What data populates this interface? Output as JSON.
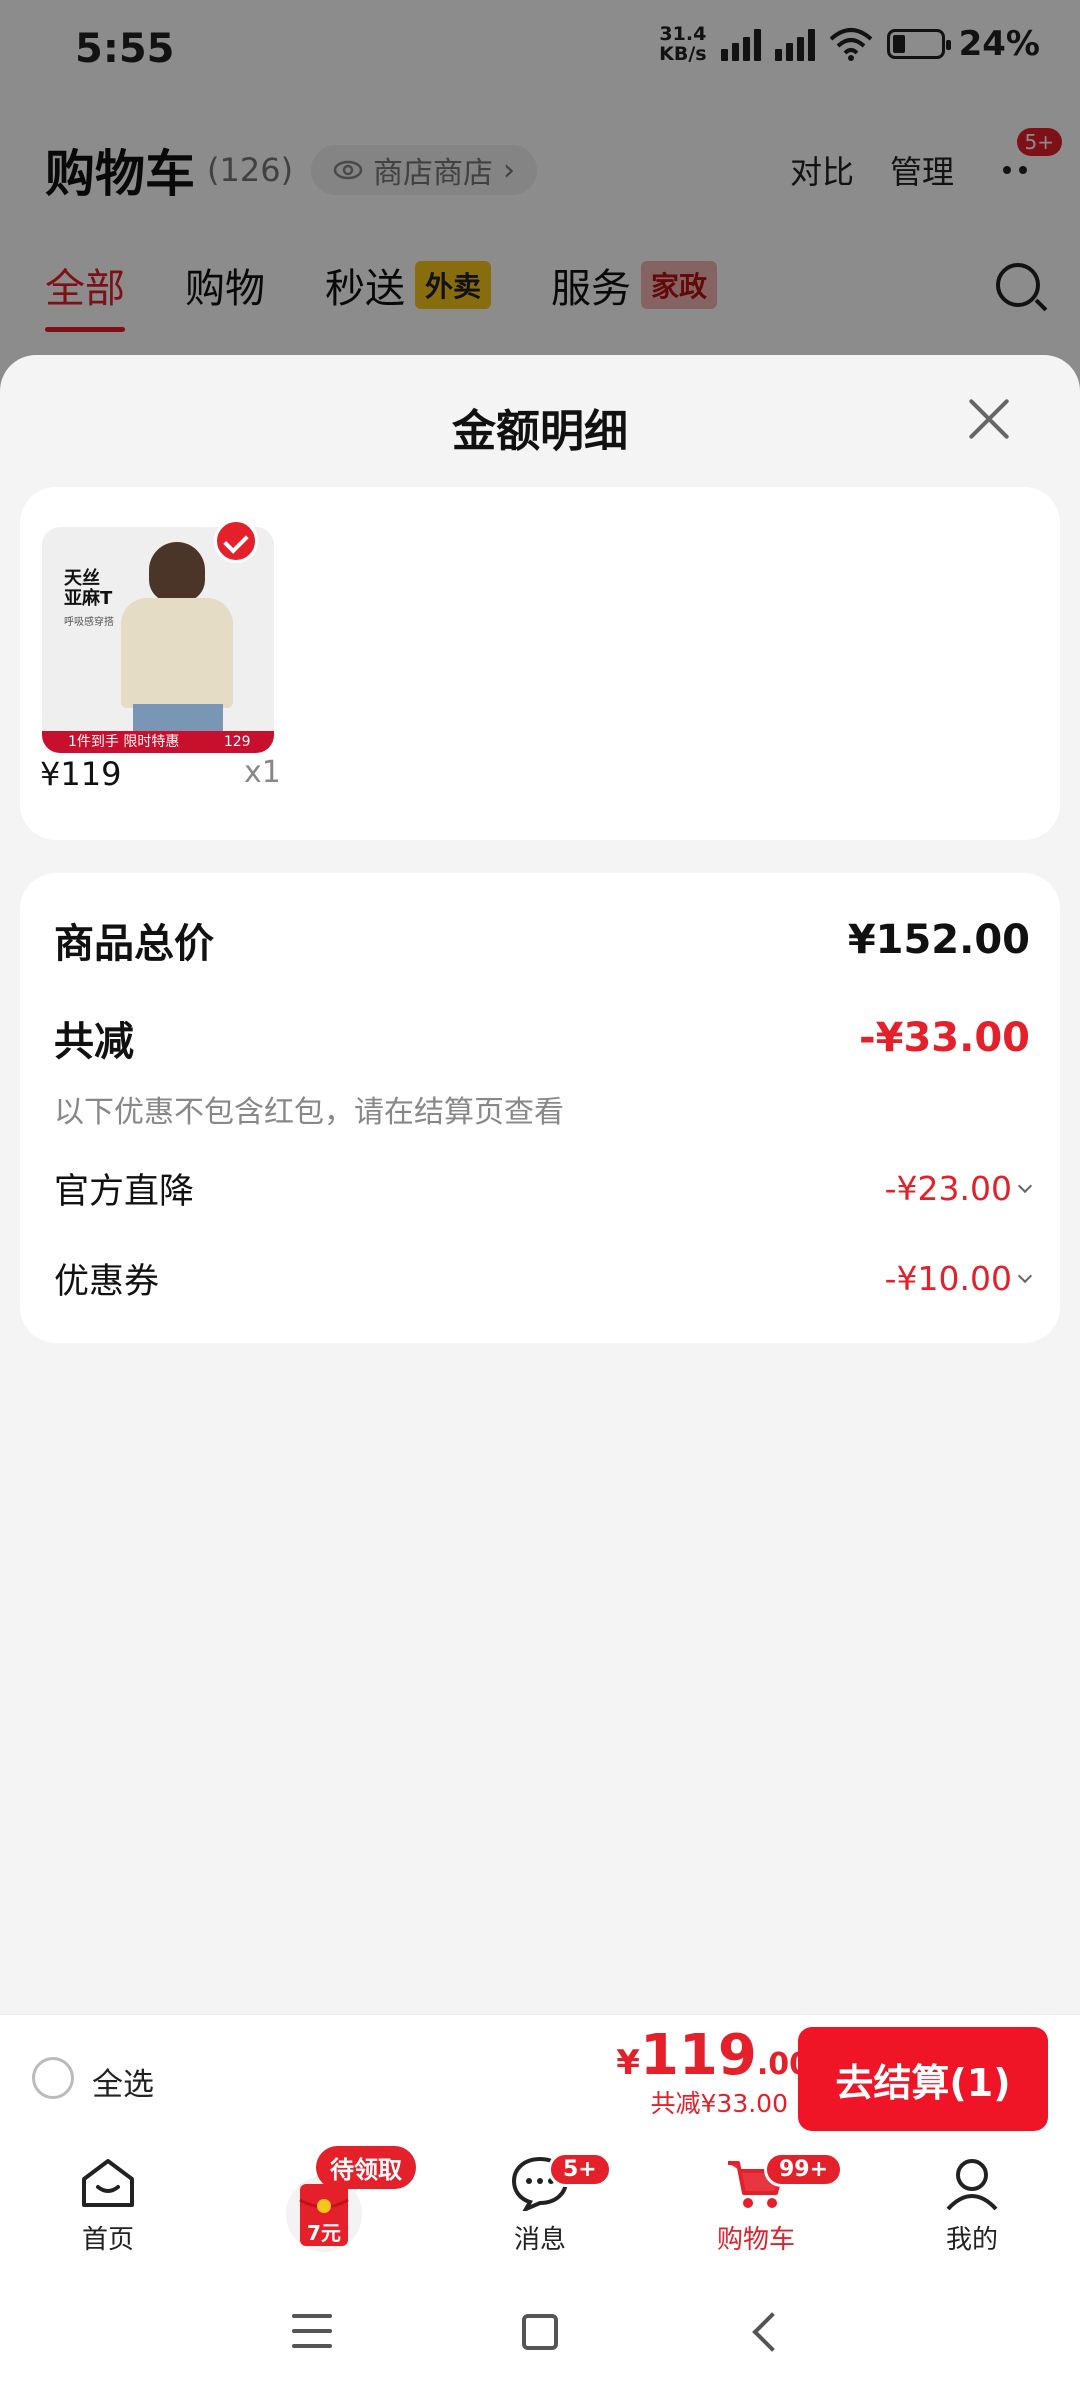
{
  "status_bar": {
    "time": "5:55",
    "net_speed_value": "31.4",
    "net_speed_unit": "KB/s",
    "battery": "24%"
  },
  "header": {
    "title": "购物车",
    "count": "(126)",
    "shop_pill": "商店商店",
    "compare": "对比",
    "manage": "管理",
    "more_badge": "5+"
  },
  "tabs": [
    {
      "label": "全部",
      "tag": ""
    },
    {
      "label": "购物",
      "tag": ""
    },
    {
      "label": "秒送",
      "tag": "外卖"
    },
    {
      "label": "服务",
      "tag": "家政"
    }
  ],
  "sheet": {
    "title": "金额明细",
    "product": {
      "thumb_title_line1": "天丝",
      "thumb_title_line2": "亚麻T",
      "thumb_subtitle": "呼吸感穿搭",
      "thumb_banner": "1件到手 限时特惠",
      "thumb_price": "129",
      "price": "¥119",
      "qty": "x1"
    },
    "summary": {
      "total_label": "商品总价",
      "total_value": "¥152.00",
      "discount_label": "共减",
      "discount_value": "-¥33.00",
      "note": "以下优惠不包含红包，请在结算页查看",
      "items": [
        {
          "label": "官方直降",
          "value": "-¥23.00"
        },
        {
          "label": "优惠券",
          "value": "-¥10.00"
        }
      ]
    }
  },
  "checkout": {
    "select_all": "全选",
    "yen": "¥",
    "amount_int": "119",
    "amount_dec": ".00",
    "discount": "共减¥33.00",
    "button": "去结算(1)"
  },
  "bottom_nav": [
    {
      "label": "首页",
      "icon": "home-icon",
      "badge": ""
    },
    {
      "label": "",
      "icon": "red-packet-icon",
      "badge": "待领取",
      "inner_text": "7元"
    },
    {
      "label": "消息",
      "icon": "message-icon",
      "badge": "5+"
    },
    {
      "label": "购物车",
      "icon": "cart-icon",
      "badge": "99+"
    },
    {
      "label": "我的",
      "icon": "user-icon",
      "badge": ""
    }
  ],
  "colors": {
    "accent": "#e4202a",
    "button": "#f01427",
    "background": "#f4f4f4"
  }
}
